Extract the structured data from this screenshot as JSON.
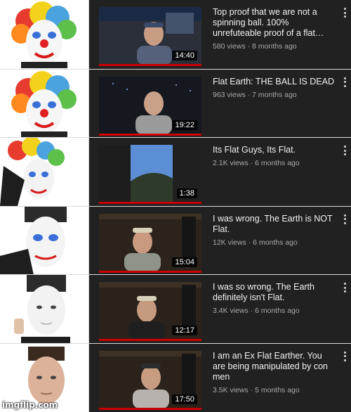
{
  "watermark": "imgflip.com",
  "videos": [
    {
      "title": "Top proof that we are not a spinning ball. 100% unrefuteable proof of a flat…",
      "meta": "580 views · 8 months ago",
      "duration": "14:40"
    },
    {
      "title": "Flat Earth: THE BALL IS DEAD",
      "meta": "963 views · 7 months ago",
      "duration": "19:22"
    },
    {
      "title": "Its Flat Guys, Its Flat.",
      "meta": "2.1K views · 6 months ago",
      "duration": "1:38"
    },
    {
      "title": "I was wrong. The Earth is NOT Flat.",
      "meta": "12K views · 6 months ago",
      "duration": "15:04"
    },
    {
      "title": "I was so wrong. The Earth definitely isn't Flat.",
      "meta": "3.4K views · 6 months ago",
      "duration": "12:17"
    },
    {
      "title": "I am an Ex Flat Earther. You are being manipulated by con men",
      "meta": "3.5K views · 5 months ago",
      "duration": "17:50"
    }
  ],
  "colors": {
    "panel": "#212121",
    "progress": "#cc0000",
    "title": "#f1f1f1",
    "meta": "#aaaaaa"
  }
}
